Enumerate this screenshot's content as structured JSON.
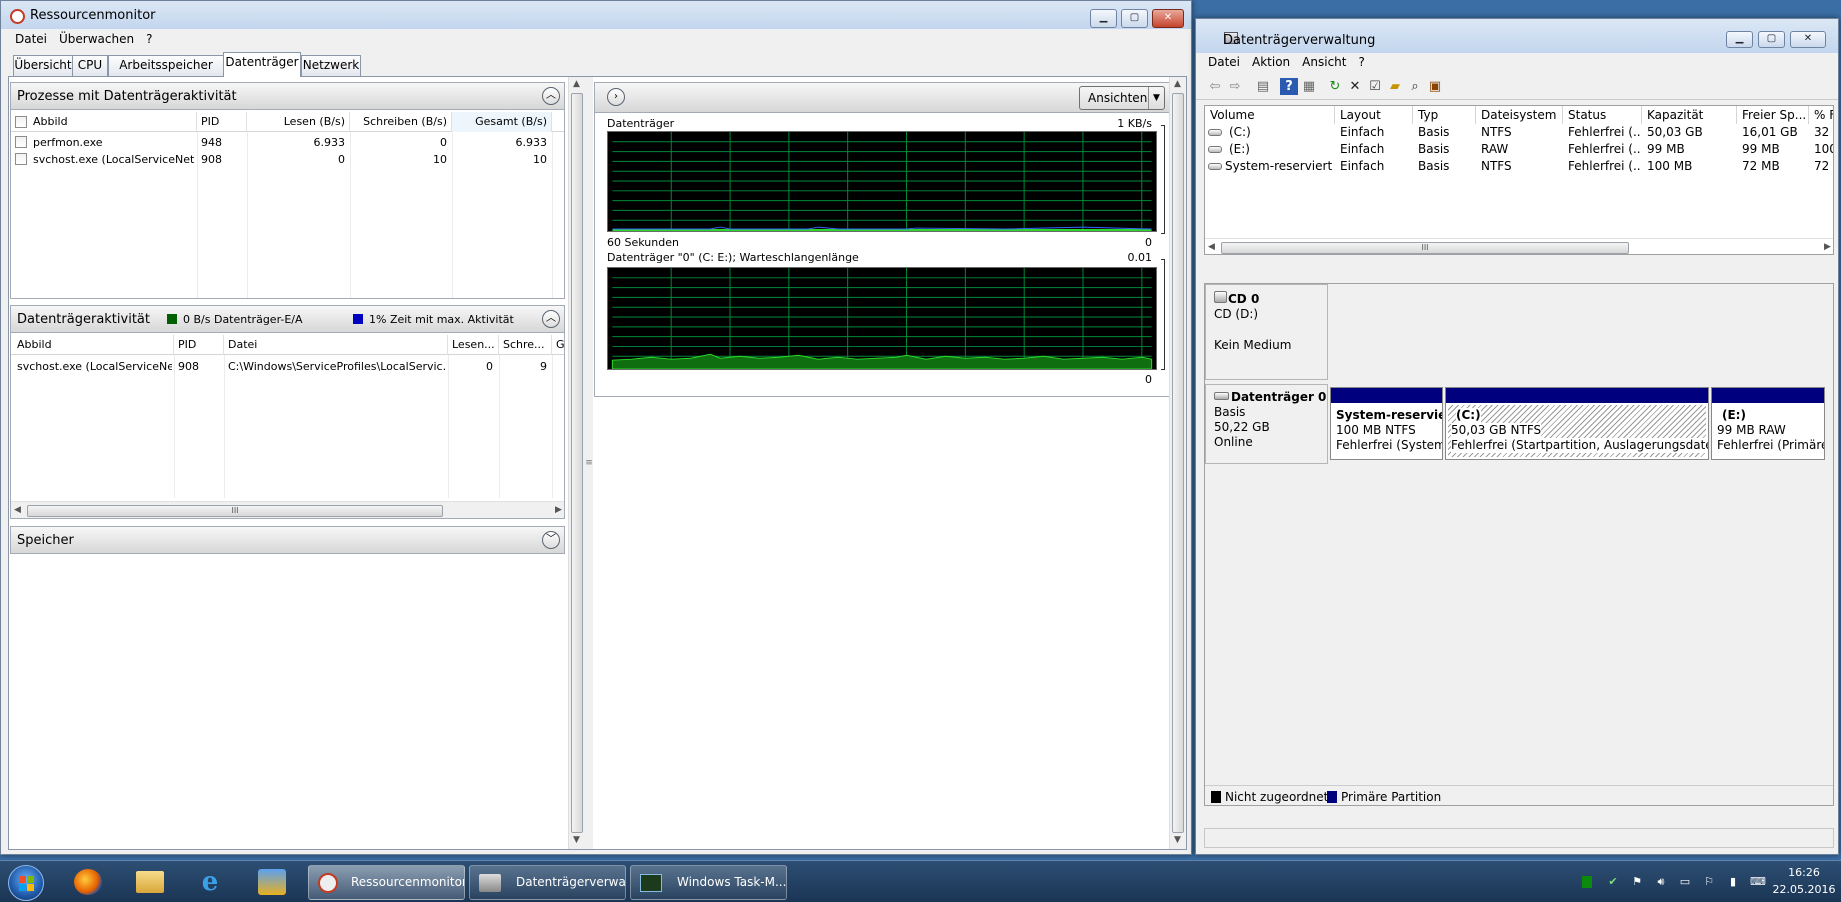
{
  "resmon": {
    "title": "Ressourcenmonitor",
    "menu": [
      "Datei",
      "Überwachen",
      "?"
    ],
    "tabs": [
      "Übersicht",
      "CPU",
      "Arbeitsspeicher",
      "Datenträger",
      "Netzwerk"
    ],
    "active_tab": "Datenträger",
    "processes": {
      "title": "Prozesse mit Datenträgeraktivität",
      "columns": [
        "Abbild",
        "PID",
        "Lesen (B/s)",
        "Schreiben (B/s)",
        "Gesamt (B/s)"
      ],
      "rows": [
        {
          "image": "perfmon.exe",
          "pid": "948",
          "read": "6.933",
          "write": "0",
          "total": "6.933"
        },
        {
          "image": "svchost.exe (LocalServiceNet...",
          "pid": "908",
          "read": "0",
          "write": "10",
          "total": "10"
        }
      ]
    },
    "activity": {
      "title": "Datenträgeraktivität",
      "legend1": "0 B/s Datenträger-E/A",
      "legend1_color": "#006000",
      "legend2": "1% Zeit mit max. Aktivität",
      "legend2_color": "#0000c0",
      "columns": [
        "Abbild",
        "PID",
        "Datei",
        "Lesen...",
        "Schre...",
        "G"
      ],
      "rows": [
        {
          "image": "svchost.exe (LocalServiceNe...",
          "pid": "908",
          "file": "C:\\Windows\\ServiceProfiles\\LocalServic...",
          "read": "0",
          "write": "9"
        }
      ],
      "scroll_grip": "III"
    },
    "memory": {
      "title": "Speicher"
    },
    "graphs": {
      "views_button": "Ansichten",
      "disk": {
        "label": "Datenträger",
        "max": "1 KB/s",
        "time": "60 Sekunden",
        "min": "0"
      },
      "queue": {
        "label": "Datenträger \"0\" (C: E:); Warteschlangenlänge",
        "max": "0.01",
        "min": "0"
      }
    }
  },
  "diskmgmt": {
    "title": "Datenträgerverwaltung",
    "menu": [
      "Datei",
      "Aktion",
      "Ansicht",
      "?"
    ],
    "columns": [
      "Volume",
      "Layout",
      "Typ",
      "Dateisystem",
      "Status",
      "Kapazität",
      "Freier Sp...",
      "% F"
    ],
    "volumes": [
      {
        "volume": "(C:)",
        "layout": "Einfach",
        "type": "Basis",
        "fs": "NTFS",
        "status": "Fehlerfrei (...",
        "capacity": "50,03 GB",
        "free": "16,01 GB",
        "pct": "32"
      },
      {
        "volume": "(E:)",
        "layout": "Einfach",
        "type": "Basis",
        "fs": "RAW",
        "status": "Fehlerfrei (...",
        "capacity": "99 MB",
        "free": "99 MB",
        "pct": "100"
      },
      {
        "volume": "System-reserviert",
        "layout": "Einfach",
        "type": "Basis",
        "fs": "NTFS",
        "status": "Fehlerfrei (...",
        "capacity": "100 MB",
        "free": "72 MB",
        "pct": "72"
      }
    ],
    "scroll_grip": "III",
    "cd": {
      "name": "CD 0",
      "type": "CD (D:)",
      "media": "Kein Medium"
    },
    "disk0": {
      "name": "Datenträger 0",
      "type": "Basis",
      "size": "50,22 GB",
      "state": "Online",
      "partitions": [
        {
          "name": "System-reservier",
          "size": "100 MB NTFS",
          "status": "Fehlerfrei (System,"
        },
        {
          "name": "(C:)",
          "size": "50,03 GB NTFS",
          "status": "Fehlerfrei (Startpartition, Auslagerungsdatei, Ab"
        },
        {
          "name": "(E:)",
          "size": "99 MB RAW",
          "status": "Fehlerfrei (Primäre"
        }
      ]
    },
    "legend": {
      "unallocated": "Nicht zugeordnet",
      "primary": "Primäre Partition",
      "unallocated_color": "#000000",
      "primary_color": "#00007f"
    }
  },
  "taskbar": {
    "buttons": [
      "Ressourcenmonitor",
      "Datenträgerverwa...",
      "Windows Task-M..."
    ],
    "time": "16:26",
    "date": "22.05.2016"
  }
}
